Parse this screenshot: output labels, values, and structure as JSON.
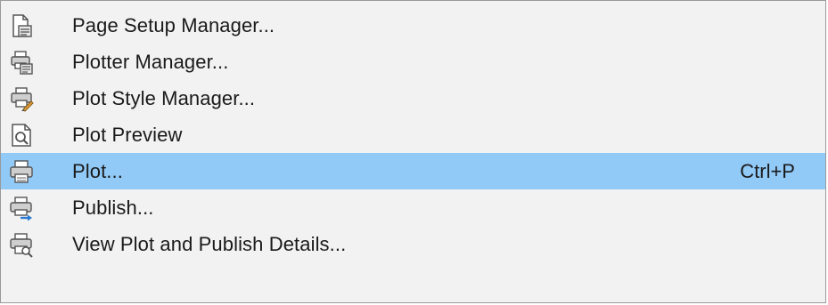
{
  "colors": {
    "menu_background": "#f2f2f2",
    "highlight": "#91c9f7",
    "text": "#1a1a1a",
    "border": "#9a9a9a"
  },
  "menu": {
    "items": [
      {
        "label": "Page Setup Manager...",
        "icon": "page-setup-icon",
        "shortcut": ""
      },
      {
        "label": "Plotter Manager...",
        "icon": "plotter-manager-icon",
        "shortcut": ""
      },
      {
        "label": "Plot Style Manager...",
        "icon": "plot-style-icon",
        "shortcut": ""
      },
      {
        "label": "Plot Preview",
        "icon": "plot-preview-icon",
        "shortcut": ""
      },
      {
        "label": "Plot...",
        "icon": "printer-icon",
        "shortcut": "Ctrl+P",
        "highlighted": true
      },
      {
        "label": "Publish...",
        "icon": "publish-icon",
        "shortcut": ""
      },
      {
        "label": "View Plot and Publish Details...",
        "icon": "plot-details-icon",
        "shortcut": ""
      }
    ]
  }
}
